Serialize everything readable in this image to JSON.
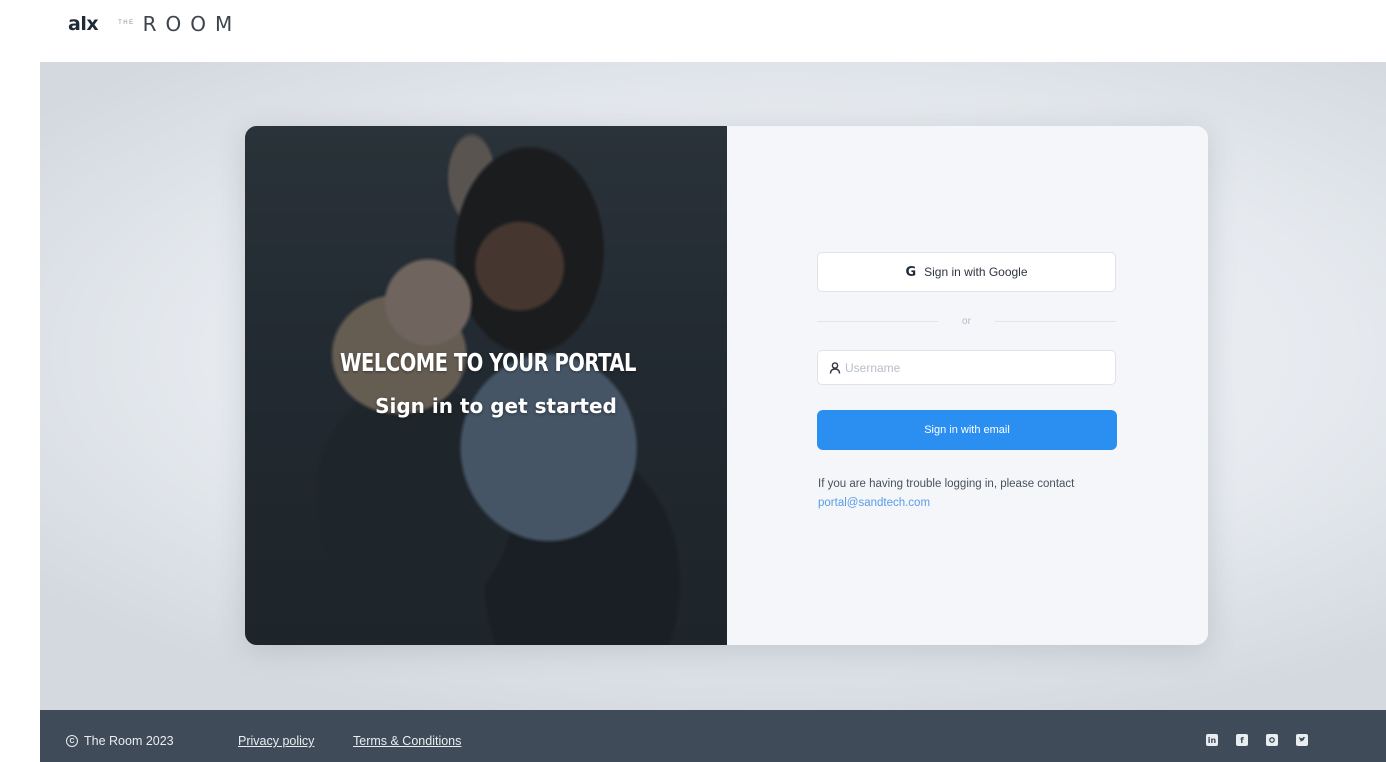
{
  "header": {
    "logo_alx": "alx",
    "logo_the": "THE",
    "logo_room": "ROOM"
  },
  "hero": {
    "title": "WELCOME TO YOUR PORTAL",
    "subtitle": "Sign in to get started"
  },
  "login": {
    "google_label": "Sign in with Google",
    "google_glyph": "G",
    "divider_label": "or",
    "username_placeholder": "Username",
    "username_value": "",
    "email_button_label": "Sign in with email",
    "help_text": "If you are having trouble logging in, please contact",
    "help_email": "portal@sandtech.com"
  },
  "footer": {
    "copyright": "The Room 2023",
    "privacy_label": "Privacy policy",
    "terms_label": "Terms & Conditions",
    "social_icons": [
      "linkedin-icon",
      "facebook-icon",
      "instagram-icon",
      "twitter-icon"
    ]
  },
  "colors": {
    "primary_button": "#2b8ff2",
    "footer_background": "#3f4b58",
    "link": "#5b9ce6"
  }
}
